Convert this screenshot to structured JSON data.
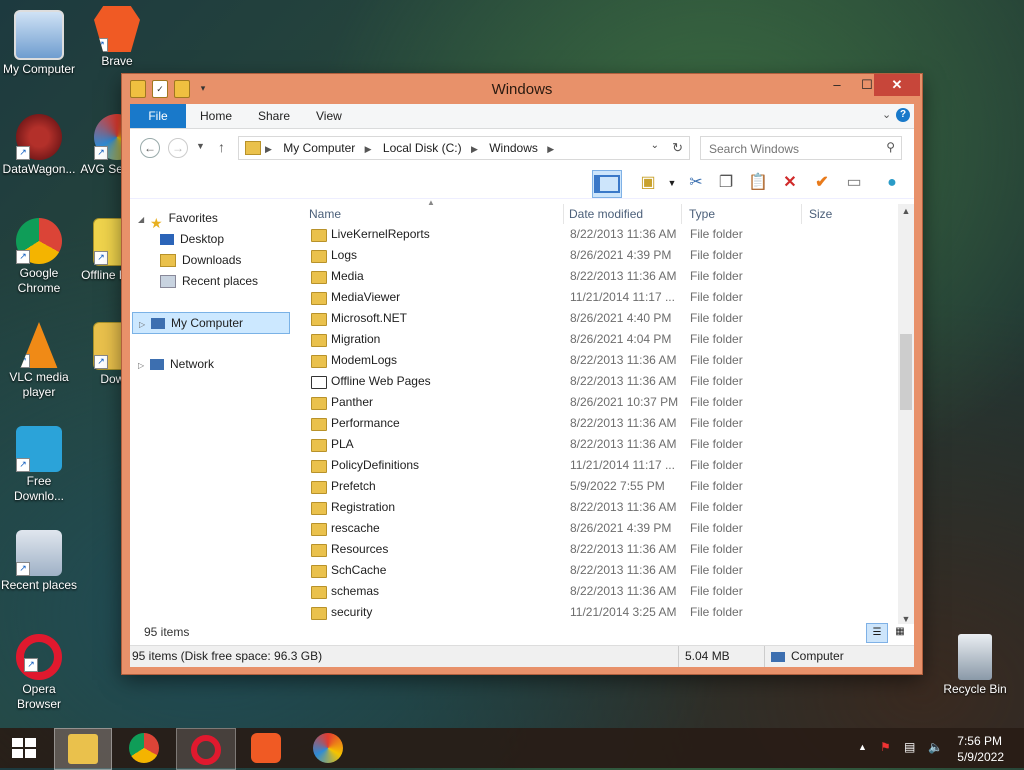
{
  "desktop": {
    "icons": [
      {
        "label": "My Computer"
      },
      {
        "label": "Brave"
      },
      {
        "label": "DataWagon..."
      },
      {
        "label": "AVG Se Brow"
      },
      {
        "label": "Google Chrome"
      },
      {
        "label": "Offline Pages"
      },
      {
        "label": "VLC media player"
      },
      {
        "label": "Downl"
      },
      {
        "label": "Free Downlo..."
      },
      {
        "label": "Recent places"
      },
      {
        "label": "Opera Browser"
      },
      {
        "label": "Recycle Bin"
      }
    ]
  },
  "window": {
    "title": "Windows",
    "controls": {
      "minimize": "–",
      "maximize": "☐",
      "close": "✕"
    },
    "ribbon": {
      "tabs": [
        "File",
        "Home",
        "Share",
        "View"
      ]
    },
    "address": {
      "crumbs": [
        "My Computer",
        "Local Disk (C:)",
        "Windows"
      ]
    },
    "search": {
      "placeholder": "Search Windows"
    },
    "nav_pane": {
      "favorites": "Favorites",
      "desktop": "Desktop",
      "downloads": "Downloads",
      "recent": "Recent places",
      "my_computer": "My Computer",
      "network": "Network"
    },
    "columns": {
      "name": "Name",
      "date": "Date modified",
      "type": "Type",
      "size": "Size"
    },
    "files": [
      {
        "name": "LiveKernelReports",
        "date": "8/22/2013 11:36 AM",
        "type": "File folder"
      },
      {
        "name": "Logs",
        "date": "8/26/2021 4:39 PM",
        "type": "File folder"
      },
      {
        "name": "Media",
        "date": "8/22/2013 11:36 AM",
        "type": "File folder"
      },
      {
        "name": "MediaViewer",
        "date": "11/21/2014 11:17 ...",
        "type": "File folder"
      },
      {
        "name": "Microsoft.NET",
        "date": "8/26/2021 4:40 PM",
        "type": "File folder"
      },
      {
        "name": "Migration",
        "date": "8/26/2021 4:04 PM",
        "type": "File folder"
      },
      {
        "name": "ModemLogs",
        "date": "8/22/2013 11:36 AM",
        "type": "File folder"
      },
      {
        "name": "Offline Web Pages",
        "date": "8/22/2013 11:36 AM",
        "type": "File folder"
      },
      {
        "name": "Panther",
        "date": "8/26/2021 10:37 PM",
        "type": "File folder"
      },
      {
        "name": "Performance",
        "date": "8/22/2013 11:36 AM",
        "type": "File folder"
      },
      {
        "name": "PLA",
        "date": "8/22/2013 11:36 AM",
        "type": "File folder"
      },
      {
        "name": "PolicyDefinitions",
        "date": "11/21/2014 11:17 ...",
        "type": "File folder"
      },
      {
        "name": "Prefetch",
        "date": "5/9/2022 7:55 PM",
        "type": "File folder"
      },
      {
        "name": "Registration",
        "date": "8/22/2013 11:36 AM",
        "type": "File folder"
      },
      {
        "name": "rescache",
        "date": "8/26/2021 4:39 PM",
        "type": "File folder"
      },
      {
        "name": "Resources",
        "date": "8/22/2013 11:36 AM",
        "type": "File folder"
      },
      {
        "name": "SchCache",
        "date": "8/22/2013 11:36 AM",
        "type": "File folder"
      },
      {
        "name": "schemas",
        "date": "8/22/2013 11:36 AM",
        "type": "File folder"
      },
      {
        "name": "security",
        "date": "11/21/2014 3:25 AM",
        "type": "File folder"
      }
    ],
    "item_count": "95 items",
    "status": {
      "left": "95 items (Disk free space: 96.3 GB)",
      "size": "5.04 MB",
      "location": "Computer"
    }
  },
  "taskbar": {
    "clock_time": "7:56 PM",
    "clock_date": "5/9/2022"
  },
  "colors": {
    "window_frame": "#e8916a",
    "accent": "#1979ca",
    "close_button": "#c7463a"
  }
}
